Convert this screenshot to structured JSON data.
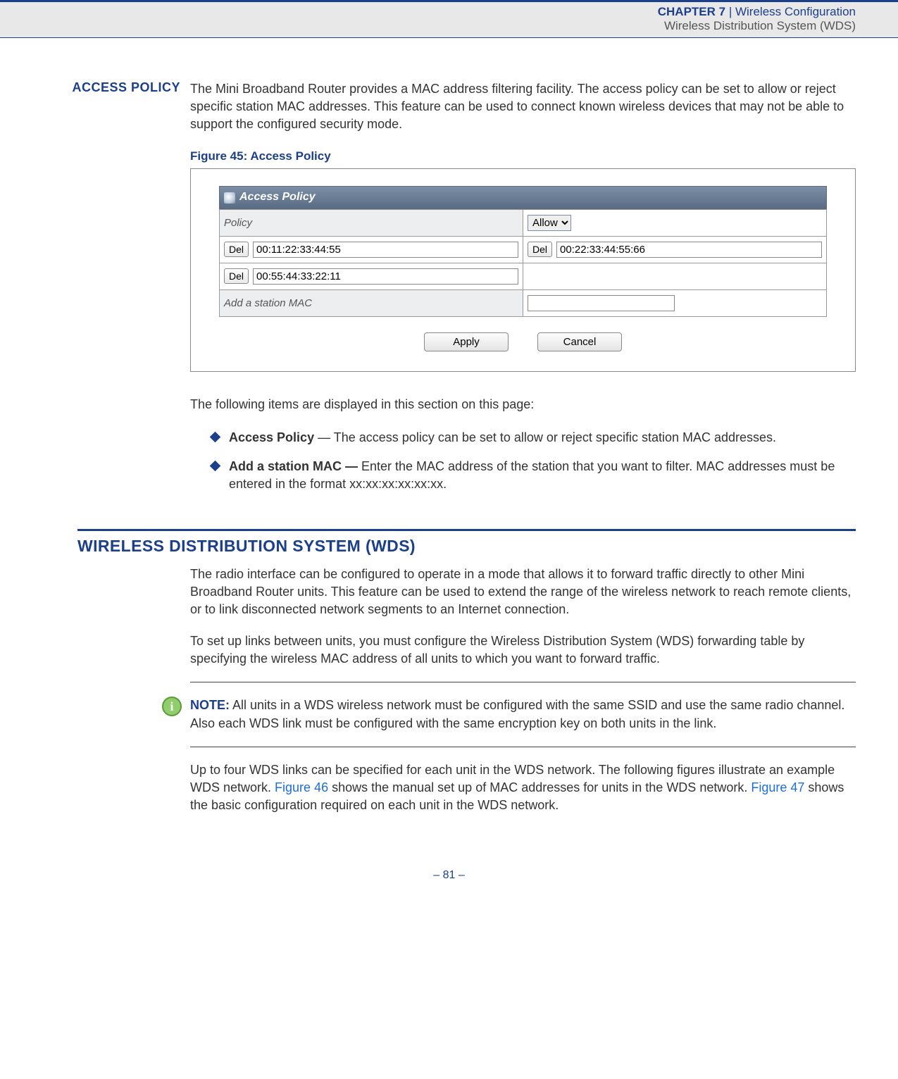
{
  "header": {
    "chapter": "CHAPTER 7",
    "sep": "  |  ",
    "title": "Wireless Configuration",
    "subtitle": "Wireless Distribution System (WDS)"
  },
  "access_policy": {
    "label": "ACCESS POLICY",
    "intro": "The Mini Broadband Router provides a MAC address filtering facility. The access policy can be set to allow or reject specific station MAC addresses. This feature can be used to connect known wireless devices that may not be able to support the configured security mode.",
    "figure_caption": "Figure 45:  Access Policy",
    "panel_title": "Access Policy",
    "policy_label": "Policy",
    "policy_value": "Allow",
    "del_label": "Del",
    "mac1": "00:11:22:33:44:55",
    "mac2": "00:22:33:44:55:66",
    "mac3": "00:55:44:33:22:11",
    "add_label": "Add a station MAC",
    "add_value": "",
    "apply": "Apply",
    "cancel": "Cancel",
    "following": "The following items are displayed in this section on this page:",
    "bullets": [
      {
        "bold": "Access Policy",
        "rest": " — The access policy can be set to allow or reject specific station MAC addresses."
      },
      {
        "bold": "Add a station MAC — ",
        "rest": "Enter the MAC address of the station that you want to filter. MAC addresses must be entered in the format xx:xx:xx:xx:xx:xx."
      }
    ]
  },
  "wds": {
    "title": "WIRELESS DISTRIBUTION SYSTEM (WDS)",
    "p1": "The radio interface can be configured to operate in a mode that allows it to forward traffic directly to other Mini Broadband Router units. This feature can be used to extend the range of the wireless network to reach remote clients, or to link disconnected network segments to an Internet connection.",
    "p2": "To set up links between units, you must configure the Wireless Distribution System (WDS) forwarding table by specifying the wireless MAC address of all units to which you want to forward traffic.",
    "note_label": "NOTE:",
    "note": " All units in a WDS wireless network must be configured with the same SSID and use the same radio channel. Also each WDS link must be configured with the same encryption key on both units in the link.",
    "p3a": "Up to four WDS links can be specified for each unit in the WDS network. The following figures illustrate an example WDS network. ",
    "link1": "Figure 46",
    "p3b": " shows the manual set up of MAC addresses for units in the WDS network. ",
    "link2": "Figure 47",
    "p3c": " shows the basic configuration required on each unit in the WDS network."
  },
  "footer": "–  81  –"
}
